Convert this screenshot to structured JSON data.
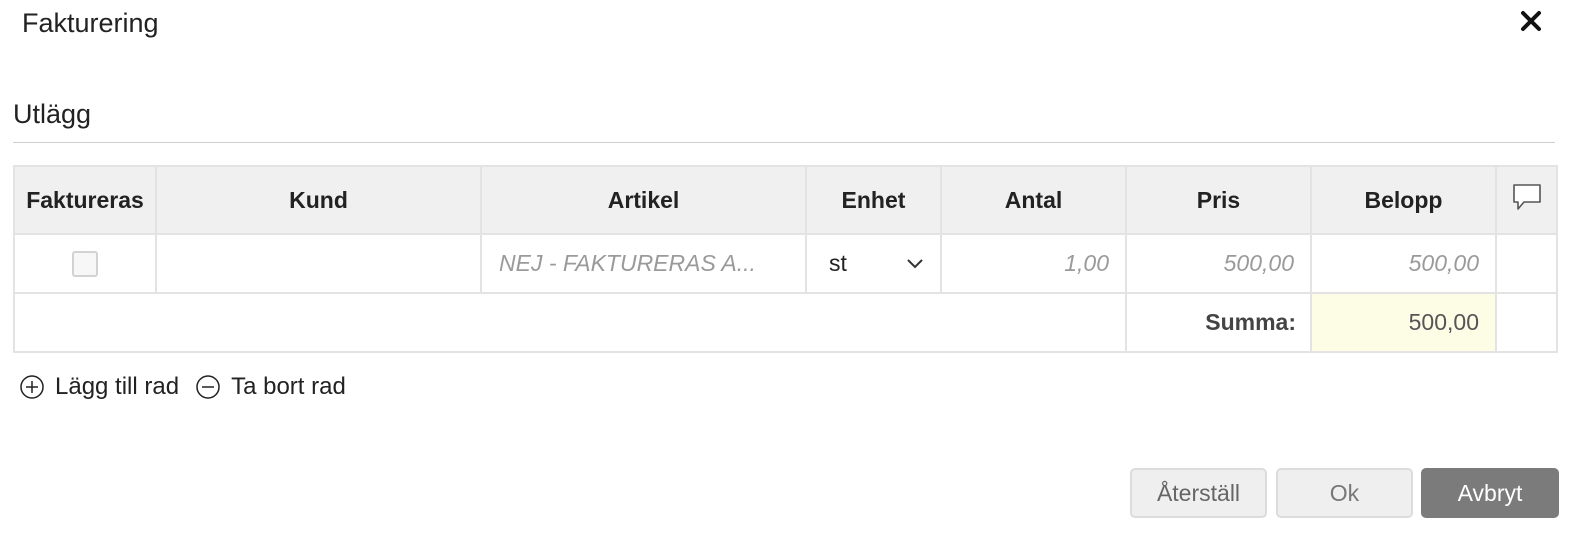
{
  "dialog": {
    "title": "Fakturering"
  },
  "section": {
    "title": "Utlägg"
  },
  "table": {
    "headers": {
      "faktureras": "Faktureras",
      "kund": "Kund",
      "artikel": "Artikel",
      "enhet": "Enhet",
      "antal": "Antal",
      "pris": "Pris",
      "belopp": "Belopp"
    },
    "rows": [
      {
        "faktureras": false,
        "kund": "",
        "artikel": "NEJ - FAKTURERAS A...",
        "enhet": "st",
        "antal": "1,00",
        "pris": "500,00",
        "belopp": "500,00"
      }
    ],
    "summary": {
      "label": "Summa:",
      "value": "500,00"
    }
  },
  "row_actions": {
    "add": "Lägg till rad",
    "remove": "Ta bort rad"
  },
  "buttons": {
    "reset": "Återställ",
    "ok": "Ok",
    "cancel": "Avbryt"
  },
  "colors": {
    "header_bg": "#f0f0f0",
    "sum_bg": "#fdfde6",
    "cancel_bg": "#7b7b7b"
  },
  "icons": [
    "close-icon",
    "comment-icon",
    "chevron-down-icon",
    "plus-circle-icon",
    "minus-circle-icon"
  ]
}
